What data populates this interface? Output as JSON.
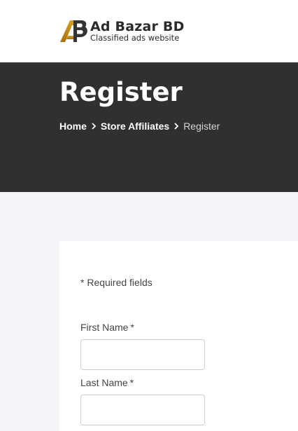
{
  "header": {
    "logo": {
      "name": "Ad Bazar BD",
      "tagline": "Classified ads website",
      "colors": {
        "gold": "#c89016",
        "dark": "#333333"
      }
    }
  },
  "title_band": {
    "title": "Register",
    "breadcrumb": [
      {
        "label": "Home"
      },
      {
        "label": "Store Affiliates"
      },
      {
        "label": "Register"
      }
    ],
    "separator_icon": "chevron-right-icon",
    "background": "#303030"
  },
  "form": {
    "required_note": "* Required fields",
    "fields": [
      {
        "label": "First Name",
        "required_mark": "*",
        "value": "",
        "placeholder": ""
      },
      {
        "label": "Last Name",
        "required_mark": "*",
        "value": "",
        "placeholder": ""
      }
    ]
  },
  "colors": {
    "page_background": "#f4f5f9",
    "card": "#ffffff",
    "input_border": "#cfcfcf"
  }
}
